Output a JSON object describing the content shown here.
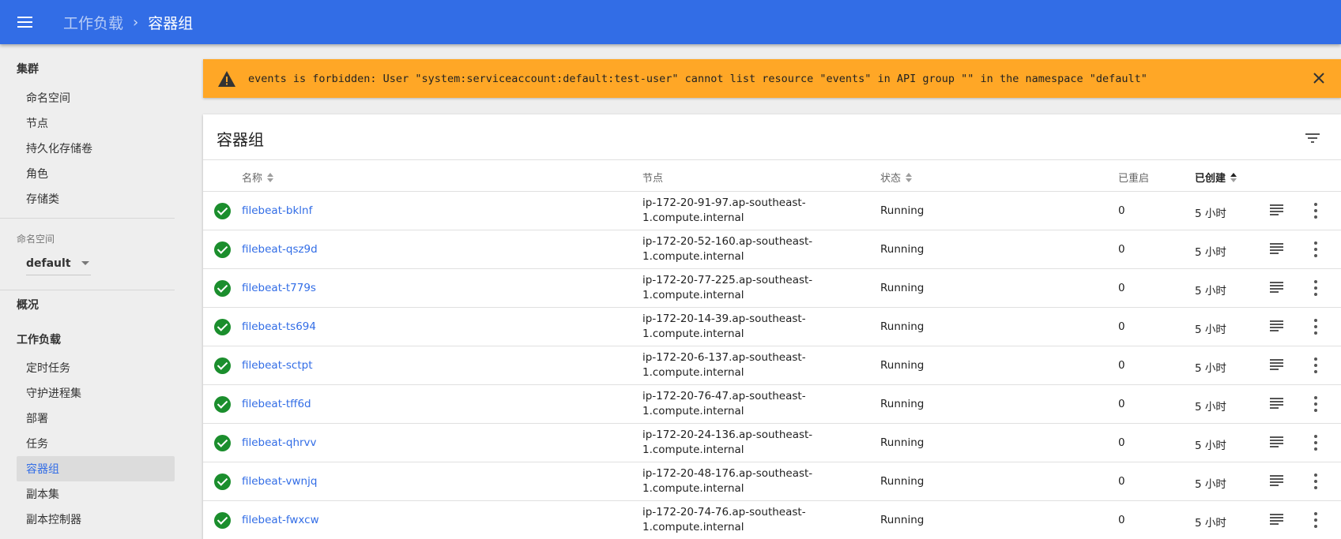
{
  "header": {
    "breadcrumb_parent": "工作负载",
    "breadcrumb_separator": "›",
    "breadcrumb_current": "容器组",
    "bar_color": "#326de6"
  },
  "sidebar": {
    "cluster_heading": "集群",
    "cluster_items": [
      "命名空间",
      "节点",
      "持久化存储卷",
      "角色",
      "存储类"
    ],
    "namespace_label": "命名空间",
    "namespace_value": "default",
    "overview": "概况",
    "workloads_heading": "工作负载",
    "workload_items": [
      "定时任务",
      "守护进程集",
      "部署",
      "任务",
      "容器组",
      "副本集",
      "副本控制器"
    ],
    "active_item": "容器组"
  },
  "alert": {
    "icon": "warning-icon",
    "message": "events is forbidden: User \"system:serviceaccount:default:test-user\" cannot list resource \"events\" in API group \"\" in the namespace \"default\"",
    "color": "#ffa726"
  },
  "pods": {
    "title": "容器组",
    "columns": {
      "name": "名称",
      "node": "节点",
      "status": "状态",
      "restarts": "已重启",
      "created": "已创建"
    },
    "sorted_by": "已创建",
    "rows": [
      {
        "name": "filebeat-bklnf",
        "node_line1": "ip-172-20-91-97.ap-southeast-",
        "node_line2": "1.compute.internal",
        "status": "Running",
        "restarts": "0",
        "age": "5 小时"
      },
      {
        "name": "filebeat-qsz9d",
        "node_line1": "ip-172-20-52-160.ap-southeast-",
        "node_line2": "1.compute.internal",
        "status": "Running",
        "restarts": "0",
        "age": "5 小时"
      },
      {
        "name": "filebeat-t779s",
        "node_line1": "ip-172-20-77-225.ap-southeast-",
        "node_line2": "1.compute.internal",
        "status": "Running",
        "restarts": "0",
        "age": "5 小时"
      },
      {
        "name": "filebeat-ts694",
        "node_line1": "ip-172-20-14-39.ap-southeast-",
        "node_line2": "1.compute.internal",
        "status": "Running",
        "restarts": "0",
        "age": "5 小时"
      },
      {
        "name": "filebeat-sctpt",
        "node_line1": "ip-172-20-6-137.ap-southeast-",
        "node_line2": "1.compute.internal",
        "status": "Running",
        "restarts": "0",
        "age": "5 小时"
      },
      {
        "name": "filebeat-tff6d",
        "node_line1": "ip-172-20-76-47.ap-southeast-",
        "node_line2": "1.compute.internal",
        "status": "Running",
        "restarts": "0",
        "age": "5 小时"
      },
      {
        "name": "filebeat-qhrvv",
        "node_line1": "ip-172-20-24-136.ap-southeast-",
        "node_line2": "1.compute.internal",
        "status": "Running",
        "restarts": "0",
        "age": "5 小时"
      },
      {
        "name": "filebeat-vwnjq",
        "node_line1": "ip-172-20-48-176.ap-southeast-",
        "node_line2": "1.compute.internal",
        "status": "Running",
        "restarts": "0",
        "age": "5 小时"
      },
      {
        "name": "filebeat-fwxcw",
        "node_line1": "ip-172-20-74-76.ap-southeast-",
        "node_line2": "1.compute.internal",
        "status": "Running",
        "restarts": "0",
        "age": "5 小时"
      }
    ]
  }
}
